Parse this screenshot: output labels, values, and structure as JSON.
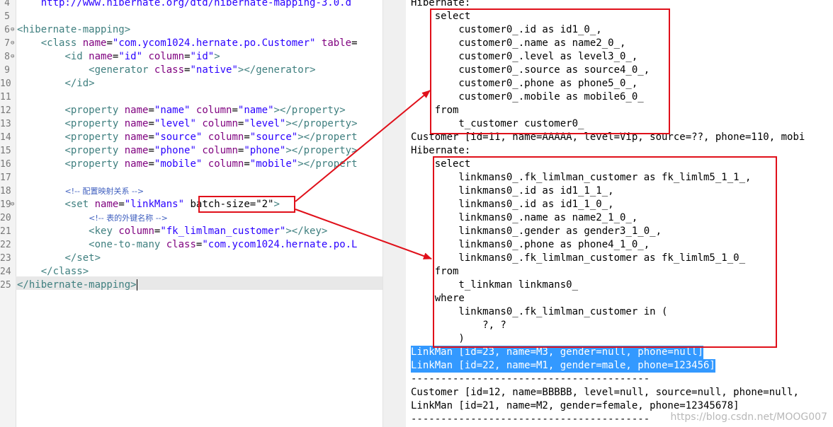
{
  "editor": {
    "line_numbers": [
      "4",
      "5",
      "6",
      "7",
      "8",
      "9",
      "10",
      "11",
      "12",
      "13",
      "14",
      "15",
      "16",
      "17",
      "18",
      "19",
      "20",
      "21",
      "22",
      "23",
      "24",
      "25"
    ],
    "doctype_url": "http://www.hibernate.org/dtd/hibernate-mapping-3.0.d",
    "comment_relation_text": "<!-- 配置映射关系 -->",
    "comment_fk_text": "<!-- 表的外键名称 -->",
    "batch_size_label": "batch-size=\"2\""
  },
  "console": {
    "lines": [
      "Hibernate:",
      "    select",
      "        customer0_.id as id1_0_,",
      "        customer0_.name as name2_0_,",
      "        customer0_.level as level3_0_,",
      "        customer0_.source as source4_0_,",
      "        customer0_.phone as phone5_0_,",
      "        customer0_.mobile as mobile6_0_",
      "    from",
      "        t_customer customer0_",
      "Customer [id=11, name=AAAAA, level=Vip, source=??, phone=110, mobi",
      "Hibernate:",
      "    select",
      "        linkmans0_.fk_limlman_customer as fk_limlm5_1_1_,",
      "        linkmans0_.id as id1_1_1_,",
      "        linkmans0_.id as id1_1_0_,",
      "        linkmans0_.name as name2_1_0_,",
      "        linkmans0_.gender as gender3_1_0_,",
      "        linkmans0_.phone as phone4_1_0_,",
      "        linkmans0_.fk_limlman_customer as fk_limlm5_1_0_",
      "    from",
      "        t_linkman linkmans0_",
      "    where",
      "        linkmans0_.fk_limlman_customer in (",
      "            ?, ?",
      "        )",
      "LinkMan [id=23, name=M3, gender=null, phone=null]",
      "LinkMan [id=22, name=M1, gender=male, phone=123456]",
      "----------------------------------------",
      "Customer [id=12, name=BBBBB, level=null, source=null, phone=null,",
      "LinkMan [id=21, name=M2, gender=female, phone=12345678]",
      "----------------------------------------"
    ]
  },
  "watermark": "https://blog.csdn.net/MOOG007",
  "colors": {
    "annotation_red": "#e0101a",
    "selection_blue": "#3399ff",
    "xml_tag": "#3f7f7f",
    "xml_attr": "#7f007f",
    "xml_value": "#2a00ff",
    "xml_comment": "#3f5fbf"
  }
}
